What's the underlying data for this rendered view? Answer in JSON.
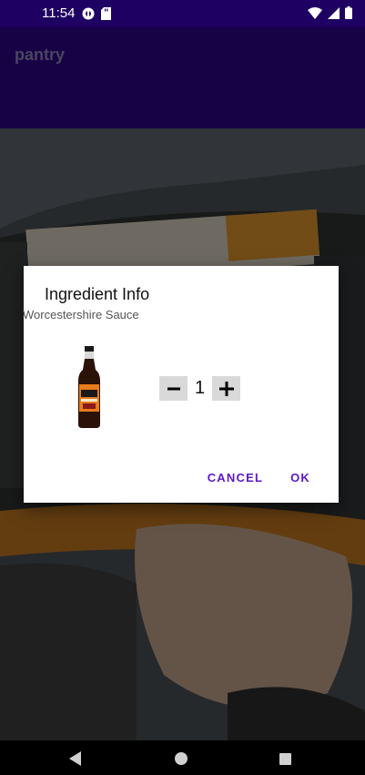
{
  "status_bar": {
    "time": "11:54",
    "icons": [
      "podcast-icon",
      "sd-card-icon",
      "wifi-icon",
      "signal-icon",
      "battery-icon"
    ]
  },
  "app_bar": {
    "title": "pantry"
  },
  "dialog": {
    "title": "Ingredient Info",
    "subtitle": "Worcestershire Sauce",
    "quantity": "1",
    "decrement_label": "−",
    "increment_label": "+",
    "cancel_label": "CANCEL",
    "ok_label": "OK"
  },
  "nav_bar": {
    "icons": [
      "back-icon",
      "home-icon",
      "recents-icon"
    ]
  },
  "colors": {
    "status_bar": "#1e0062",
    "app_bar": "#2a0580",
    "accent": "#5b17c9"
  }
}
